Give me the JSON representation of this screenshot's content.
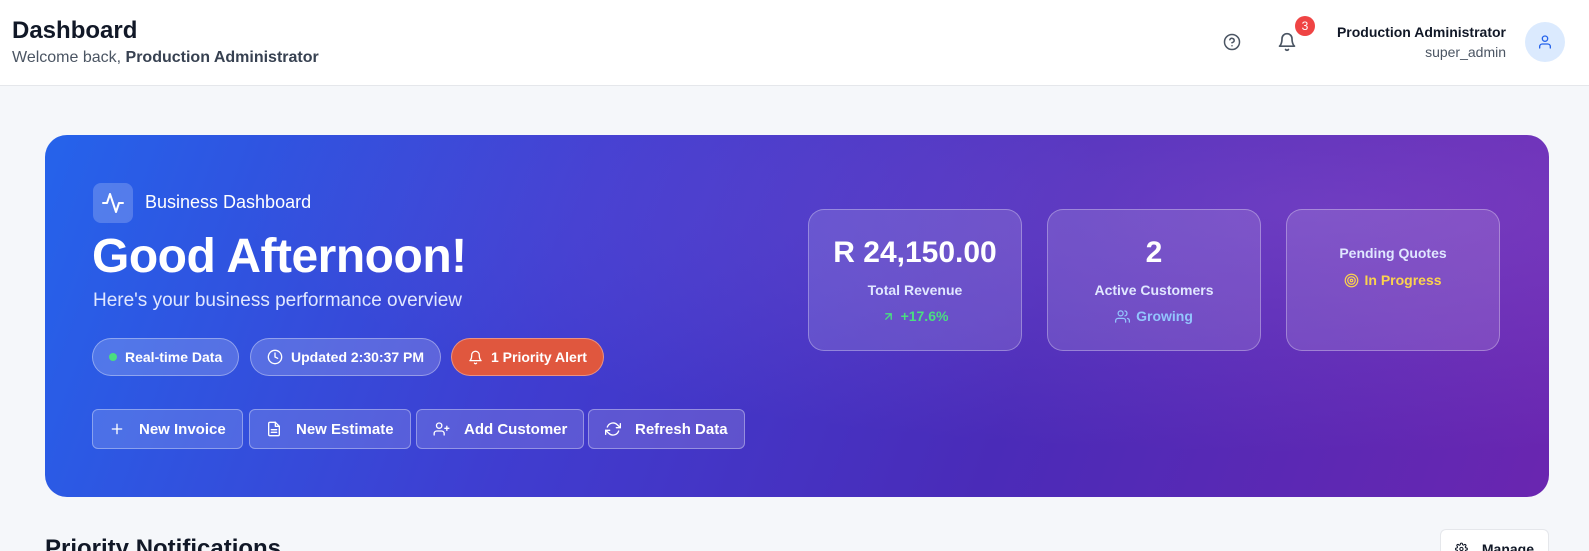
{
  "header": {
    "title": "Dashboard",
    "welcome_prefix": "Welcome back,",
    "welcome_name": "Production Administrator",
    "notification_count": "3",
    "user_name": "Production Administrator",
    "user_role": "super_admin"
  },
  "hero": {
    "tag": "Business Dashboard",
    "greeting": "Good Afternoon!",
    "subtitle": "Here's your business performance overview",
    "pills": {
      "realtime": "Real-time Data",
      "updated": "Updated 2:30:37 PM",
      "alert": "1 Priority Alert"
    },
    "actions": {
      "new_invoice": "New Invoice",
      "new_estimate": "New Estimate",
      "add_customer": "Add Customer",
      "refresh_data": "Refresh Data"
    },
    "stats": {
      "revenue_value": "R 24,150.00",
      "revenue_label": "Total Revenue",
      "revenue_trend": "+17.6%",
      "customers_value": "2",
      "customers_label": "Active Customers",
      "customers_trend": "Growing",
      "quotes_label": "Pending Quotes",
      "quotes_status": "In Progress"
    }
  },
  "notifications_section": {
    "title": "Priority Notifications",
    "manage_label": "Manage"
  },
  "colors": {
    "accent_blue": "#2563eb",
    "accent_purple": "#6a26b0",
    "alert_orange": "#e0573e",
    "badge_red": "#ef4444",
    "trend_green": "#4ade80",
    "status_amber": "#fcd34d"
  },
  "icons": {
    "help": "help-circle-icon",
    "bell": "bell-icon",
    "avatar": "user-icon",
    "hero": "activity-icon",
    "updated": "clock-icon",
    "alert": "bell-icon",
    "new_invoice": "plus-icon",
    "new_estimate": "file-text-icon",
    "add_customer": "user-plus-icon",
    "refresh": "refresh-icon",
    "revenue_trend": "arrow-up-right-icon",
    "customers_trend": "users-icon",
    "quotes_status": "target-icon",
    "manage": "gear-icon"
  }
}
